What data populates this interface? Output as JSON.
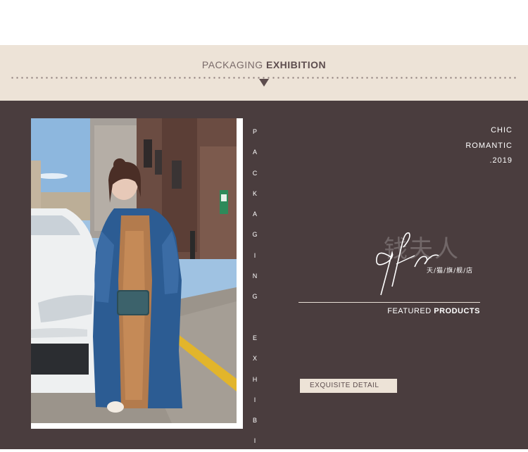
{
  "banner": {
    "title_light": "PACKAGING",
    "title_bold": "EXHIBITION"
  },
  "side_text": {
    "letters": [
      "P",
      "A",
      "C",
      "K",
      "A",
      "G",
      "I",
      "N",
      "G",
      "",
      "E",
      "X",
      "H",
      "I",
      "B",
      "I"
    ]
  },
  "corner": {
    "line1": "CHIC",
    "line2": "ROMANTIC",
    "line3": ".2019"
  },
  "logo": {
    "chinese": "钱夫人",
    "script": "qfr",
    "subtitle": "天/猫/旗/舰/店"
  },
  "featured": {
    "light": "FEATURED",
    "bold": "PRODUCTS"
  },
  "detail_button": {
    "label": "EXQUISITE DETAIL"
  },
  "photo": {
    "description_icon": "model-photo"
  },
  "colors": {
    "banner_bg": "#ede3d7",
    "panel_bg": "#4a3d3e",
    "accent_text": "#5d4d4e"
  }
}
